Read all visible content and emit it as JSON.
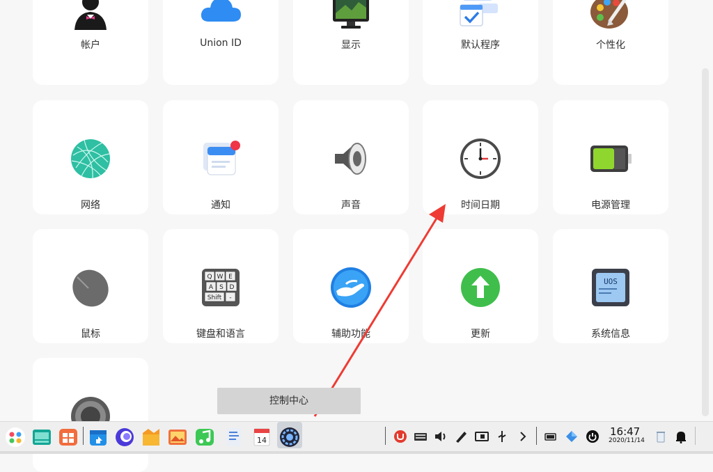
{
  "cards": [
    {
      "label": "帐户",
      "icon": "account-icon"
    },
    {
      "label": "Union ID",
      "icon": "cloud-icon"
    },
    {
      "label": "显示",
      "icon": "display-icon"
    },
    {
      "label": "默认程序",
      "icon": "default-apps-icon"
    },
    {
      "label": "个性化",
      "icon": "palette-icon"
    },
    {
      "label": "网络",
      "icon": "network-icon"
    },
    {
      "label": "通知",
      "icon": "notification-icon"
    },
    {
      "label": "声音",
      "icon": "speaker-icon"
    },
    {
      "label": "时间日期",
      "icon": "clock-icon"
    },
    {
      "label": "电源管理",
      "icon": "battery-icon"
    },
    {
      "label": "鼠标",
      "icon": "mouse-icon"
    },
    {
      "label": "键盘和语言",
      "icon": "keyboard-icon"
    },
    {
      "label": "辅助功能",
      "icon": "accessibility-icon"
    },
    {
      "label": "更新",
      "icon": "update-icon"
    },
    {
      "label": "系统信息",
      "icon": "system-info-icon"
    },
    {
      "label": "",
      "icon": "general-settings-gear-icon"
    }
  ],
  "tooltip": {
    "text": "控制中心"
  },
  "keyboard_keys": [
    "Q",
    "W",
    "E",
    "A",
    "S",
    "D",
    "Shift",
    "-"
  ],
  "system_info_badge": "UOS",
  "calendar_day": "14",
  "taskbar": {
    "time": "16:47",
    "date": "2020/11/14"
  },
  "colors": {
    "accent": "#2ca7f8",
    "arrow": "#ee3b33"
  }
}
